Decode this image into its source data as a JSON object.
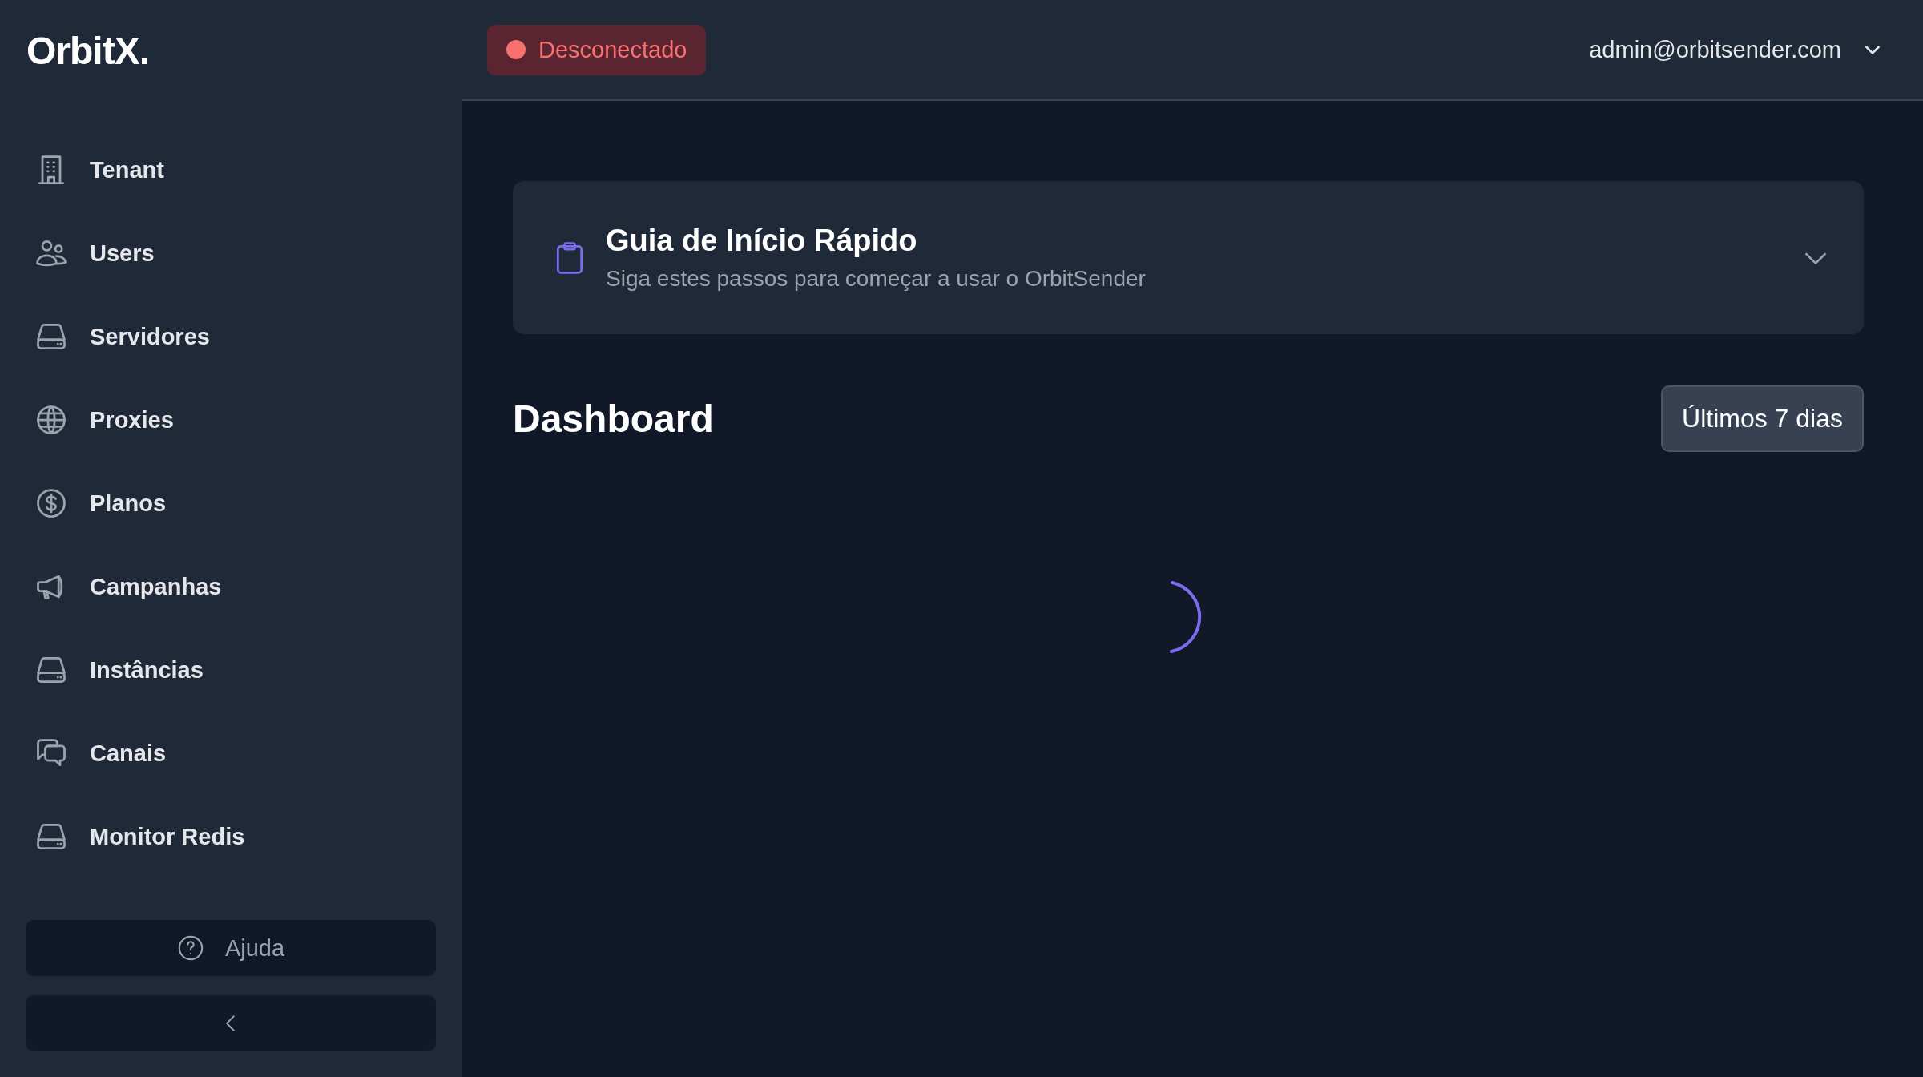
{
  "sidebar": {
    "logo": "OrbitX.",
    "items": [
      {
        "label": "Tenant",
        "kind": "building"
      },
      {
        "label": "Users",
        "kind": "users"
      },
      {
        "label": "Servidores",
        "kind": "server"
      },
      {
        "label": "Proxies",
        "kind": "globe"
      },
      {
        "label": "Planos",
        "kind": "dollar"
      },
      {
        "label": "Campanhas",
        "kind": "megaphone"
      },
      {
        "label": "Instâncias",
        "kind": "server"
      },
      {
        "label": "Canais",
        "kind": "chat"
      },
      {
        "label": "Monitor Redis",
        "kind": "server"
      }
    ],
    "help_button": "Ajuda"
  },
  "top_bar": {
    "status": {
      "label": "Desconectado",
      "connected": false
    },
    "user_menu": "admin@orbitsender.com"
  },
  "guide": {
    "title": "Guia de Início Rápido",
    "subtitle": "Siga estes passos para começar a usar o OrbitSender",
    "expanded": false
  },
  "dashboard": {
    "title": "Dashboard",
    "period_select": "Últimos 7 dias",
    "loading": true
  }
}
